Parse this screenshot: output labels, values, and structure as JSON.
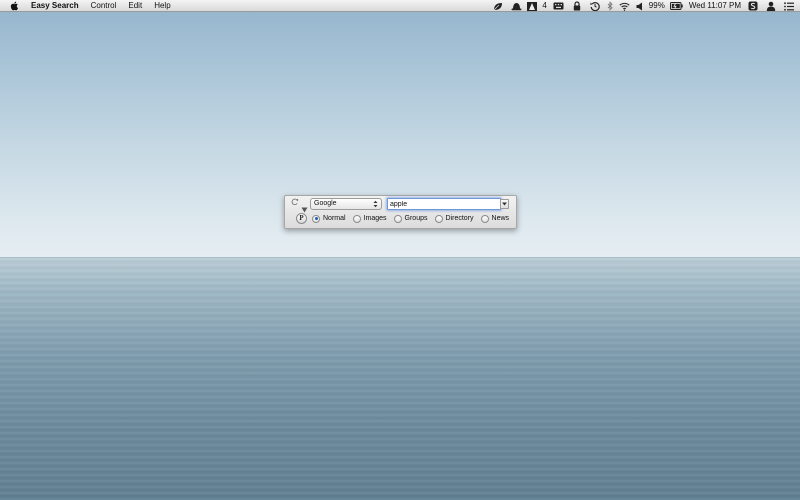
{
  "menubar": {
    "app_name": "Easy Search",
    "menus": [
      "Control",
      "Edit",
      "Help"
    ],
    "status": {
      "adobe_count": "4",
      "battery_percent": "99%",
      "clock": "Wed 11:07 PM"
    },
    "icons": [
      "apple-icon",
      "leaf-icon",
      "hat-icon",
      "adobe-icon",
      "keyboard-icon",
      "lock-icon",
      "time-machine-icon",
      "bluetooth-icon",
      "wifi-icon",
      "volume-icon",
      "battery-icon",
      "skype-icon",
      "user-icon",
      "list-icon"
    ]
  },
  "search_panel": {
    "engine": "Google",
    "query": "apple",
    "p_label": "P",
    "options": [
      {
        "label": "Normal",
        "checked": true
      },
      {
        "label": "Images",
        "checked": false
      },
      {
        "label": "Groups",
        "checked": false
      },
      {
        "label": "Directory",
        "checked": false
      },
      {
        "label": "News",
        "checked": false
      }
    ]
  },
  "colors": {
    "accent": "#1d5fb8",
    "focus_ring": "#6d97d6"
  }
}
